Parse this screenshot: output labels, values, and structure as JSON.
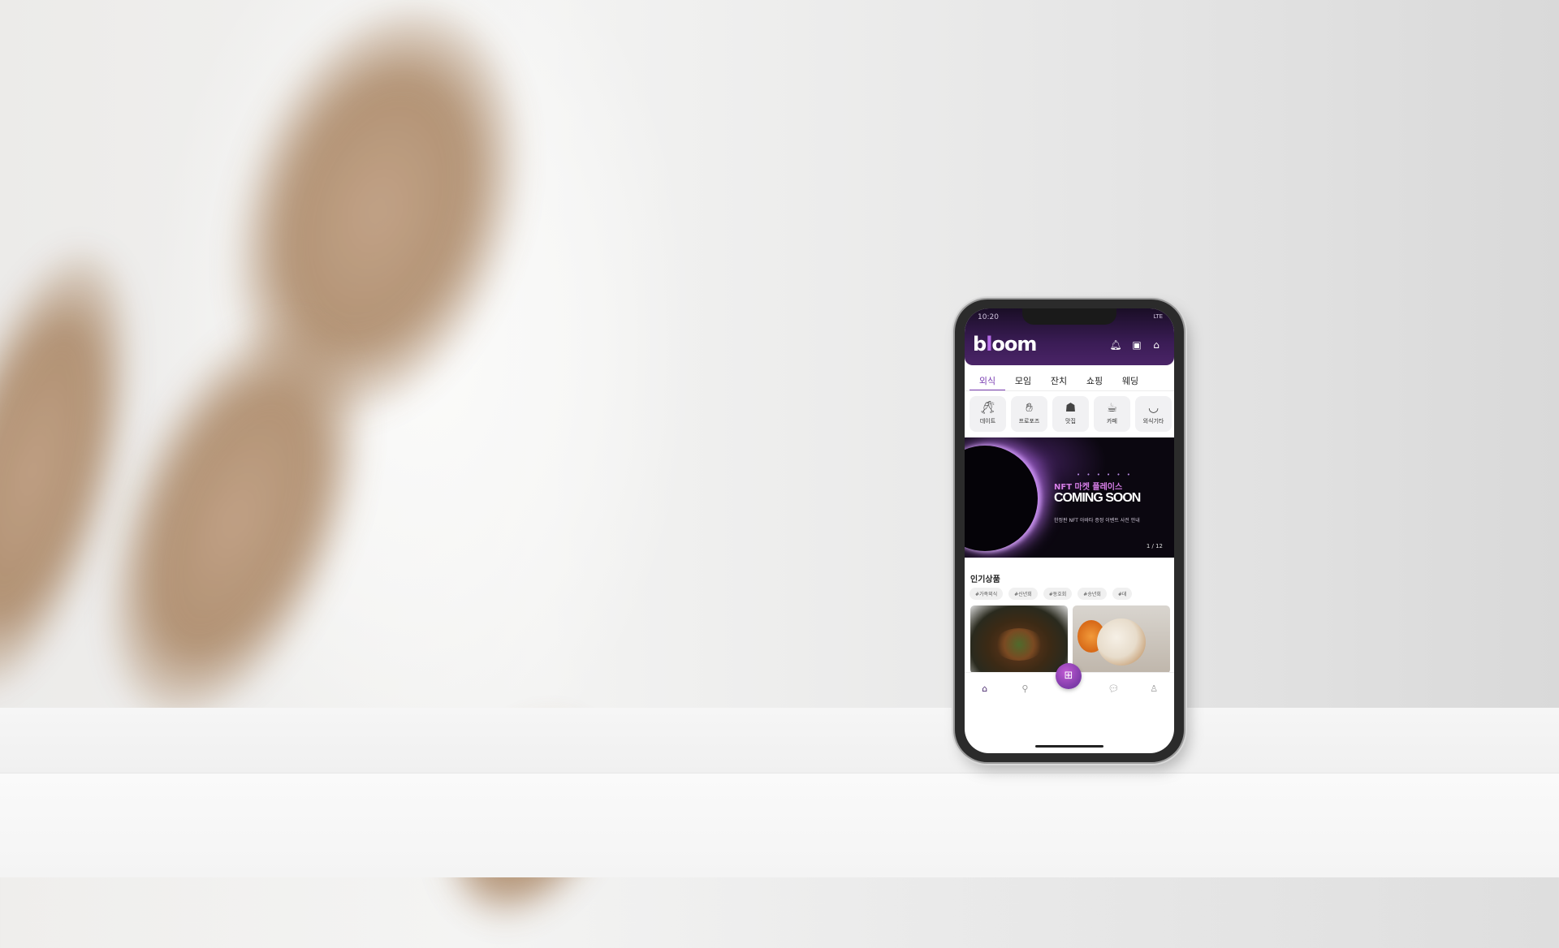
{
  "status": {
    "time": "10:20",
    "signal": "LTE"
  },
  "app": {
    "logo_letters": [
      "b",
      "l",
      "o",
      "o",
      "m"
    ]
  },
  "header_icons": [
    {
      "name": "bell-icon",
      "glyph": "🔔︎"
    },
    {
      "name": "coupon-icon",
      "glyph": "▣"
    },
    {
      "name": "shopping-bag-icon",
      "glyph": "⌂"
    }
  ],
  "tabs": [
    "외식",
    "모임",
    "잔치",
    "쇼핑",
    "웨딩"
  ],
  "active_tab": "외식",
  "categories": [
    {
      "label": "데이트",
      "icon": "wine-glass-icon",
      "glyph": "🥂︎"
    },
    {
      "label": "프로포즈",
      "icon": "proposal-icon",
      "glyph": "✋︎"
    },
    {
      "label": "맛집",
      "icon": "chef-hat-icon",
      "glyph": "☗"
    },
    {
      "label": "카페",
      "icon": "cafe-drink-icon",
      "glyph": "☕︎"
    },
    {
      "label": "외식기타",
      "icon": "bowl-icon",
      "glyph": "◡"
    }
  ],
  "banner": {
    "dots": "• • • • • •",
    "subtitle": "NFT 마켓 플레이스",
    "title": "COMING SOON",
    "description": "한정판 NFT 아바타 증정 이벤트 사전 안내",
    "page": "1 / 12"
  },
  "popular": {
    "title": "인기상품",
    "tags": [
      "#가족외식",
      "#신년회",
      "#동호회",
      "#송년회",
      "#데"
    ]
  },
  "bottom_nav": [
    {
      "name": "home-icon",
      "glyph": "⌂"
    },
    {
      "name": "location-pin-icon",
      "glyph": "⚲"
    },
    {
      "name": "chat-icon",
      "glyph": "💬︎"
    },
    {
      "name": "profile-icon",
      "glyph": "♙"
    }
  ],
  "bottom_nav_center": {
    "name": "grid-menu-icon",
    "glyph": "⊞"
  },
  "colors": {
    "brand_purple": "#7b3fb3",
    "header_dark": "#1a0e26",
    "accent_pink": "#d77ee8"
  }
}
